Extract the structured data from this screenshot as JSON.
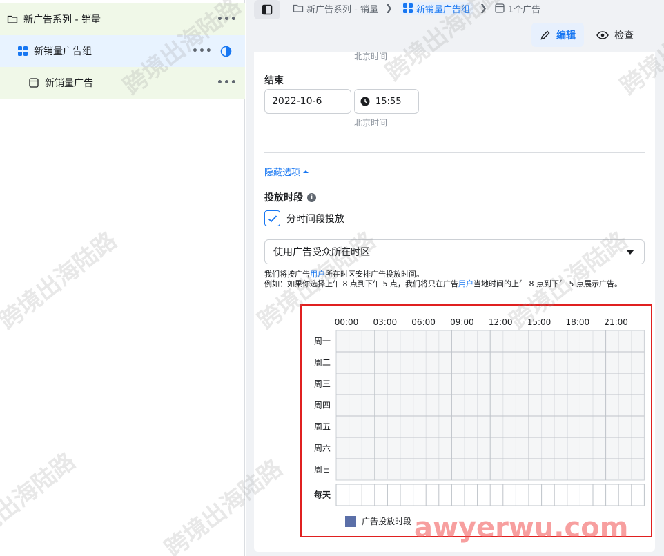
{
  "tree": {
    "campaign": {
      "label": "新广告系列 - 销量"
    },
    "adset": {
      "label": "新销量广告组"
    },
    "ad": {
      "label": "新销量广告"
    },
    "more": "•••"
  },
  "breadcrumb": {
    "campaign": "新广告系列 - 销量",
    "adset": "新销量广告组",
    "ads": "1个广告"
  },
  "toolbar": {
    "edit_label": "编辑",
    "check_label": "检查"
  },
  "form": {
    "tz_hint_top": "北京时间",
    "end_label": "结束",
    "end_date": "2022-10-6",
    "end_time": "15:55",
    "tz_hint": "北京时间",
    "hide_options": "隐藏选项",
    "schedule_label": "投放时段",
    "checkbox_label": "分时间段投放",
    "timezone_select": "使用广告受众所在时区",
    "desc_line1_a": "我们将按广告",
    "desc_user": "用户",
    "desc_line1_b": "所在时区安排广告投放时间。",
    "desc_line2_a": "例如：如果你选择上午 8 点到下午 5 点，我们将只在广告",
    "desc_line2_b": "当地时间的上午 8 点到下午 5 点展示广告。"
  },
  "schedule": {
    "hours": [
      "00:00",
      "03:00",
      "06:00",
      "09:00",
      "12:00",
      "15:00",
      "18:00",
      "21:00"
    ],
    "days": [
      "周一",
      "周二",
      "周三",
      "周四",
      "周五",
      "周六",
      "周日"
    ],
    "everyday": "每天",
    "legend": "广告投放时段"
  },
  "watermarks": {
    "text": "跨境出海陆路",
    "site": "awyerwu.com"
  },
  "colors": {
    "accent": "#1877f2",
    "highlight_box": "#e02020",
    "legend": "#5b6fa8"
  }
}
